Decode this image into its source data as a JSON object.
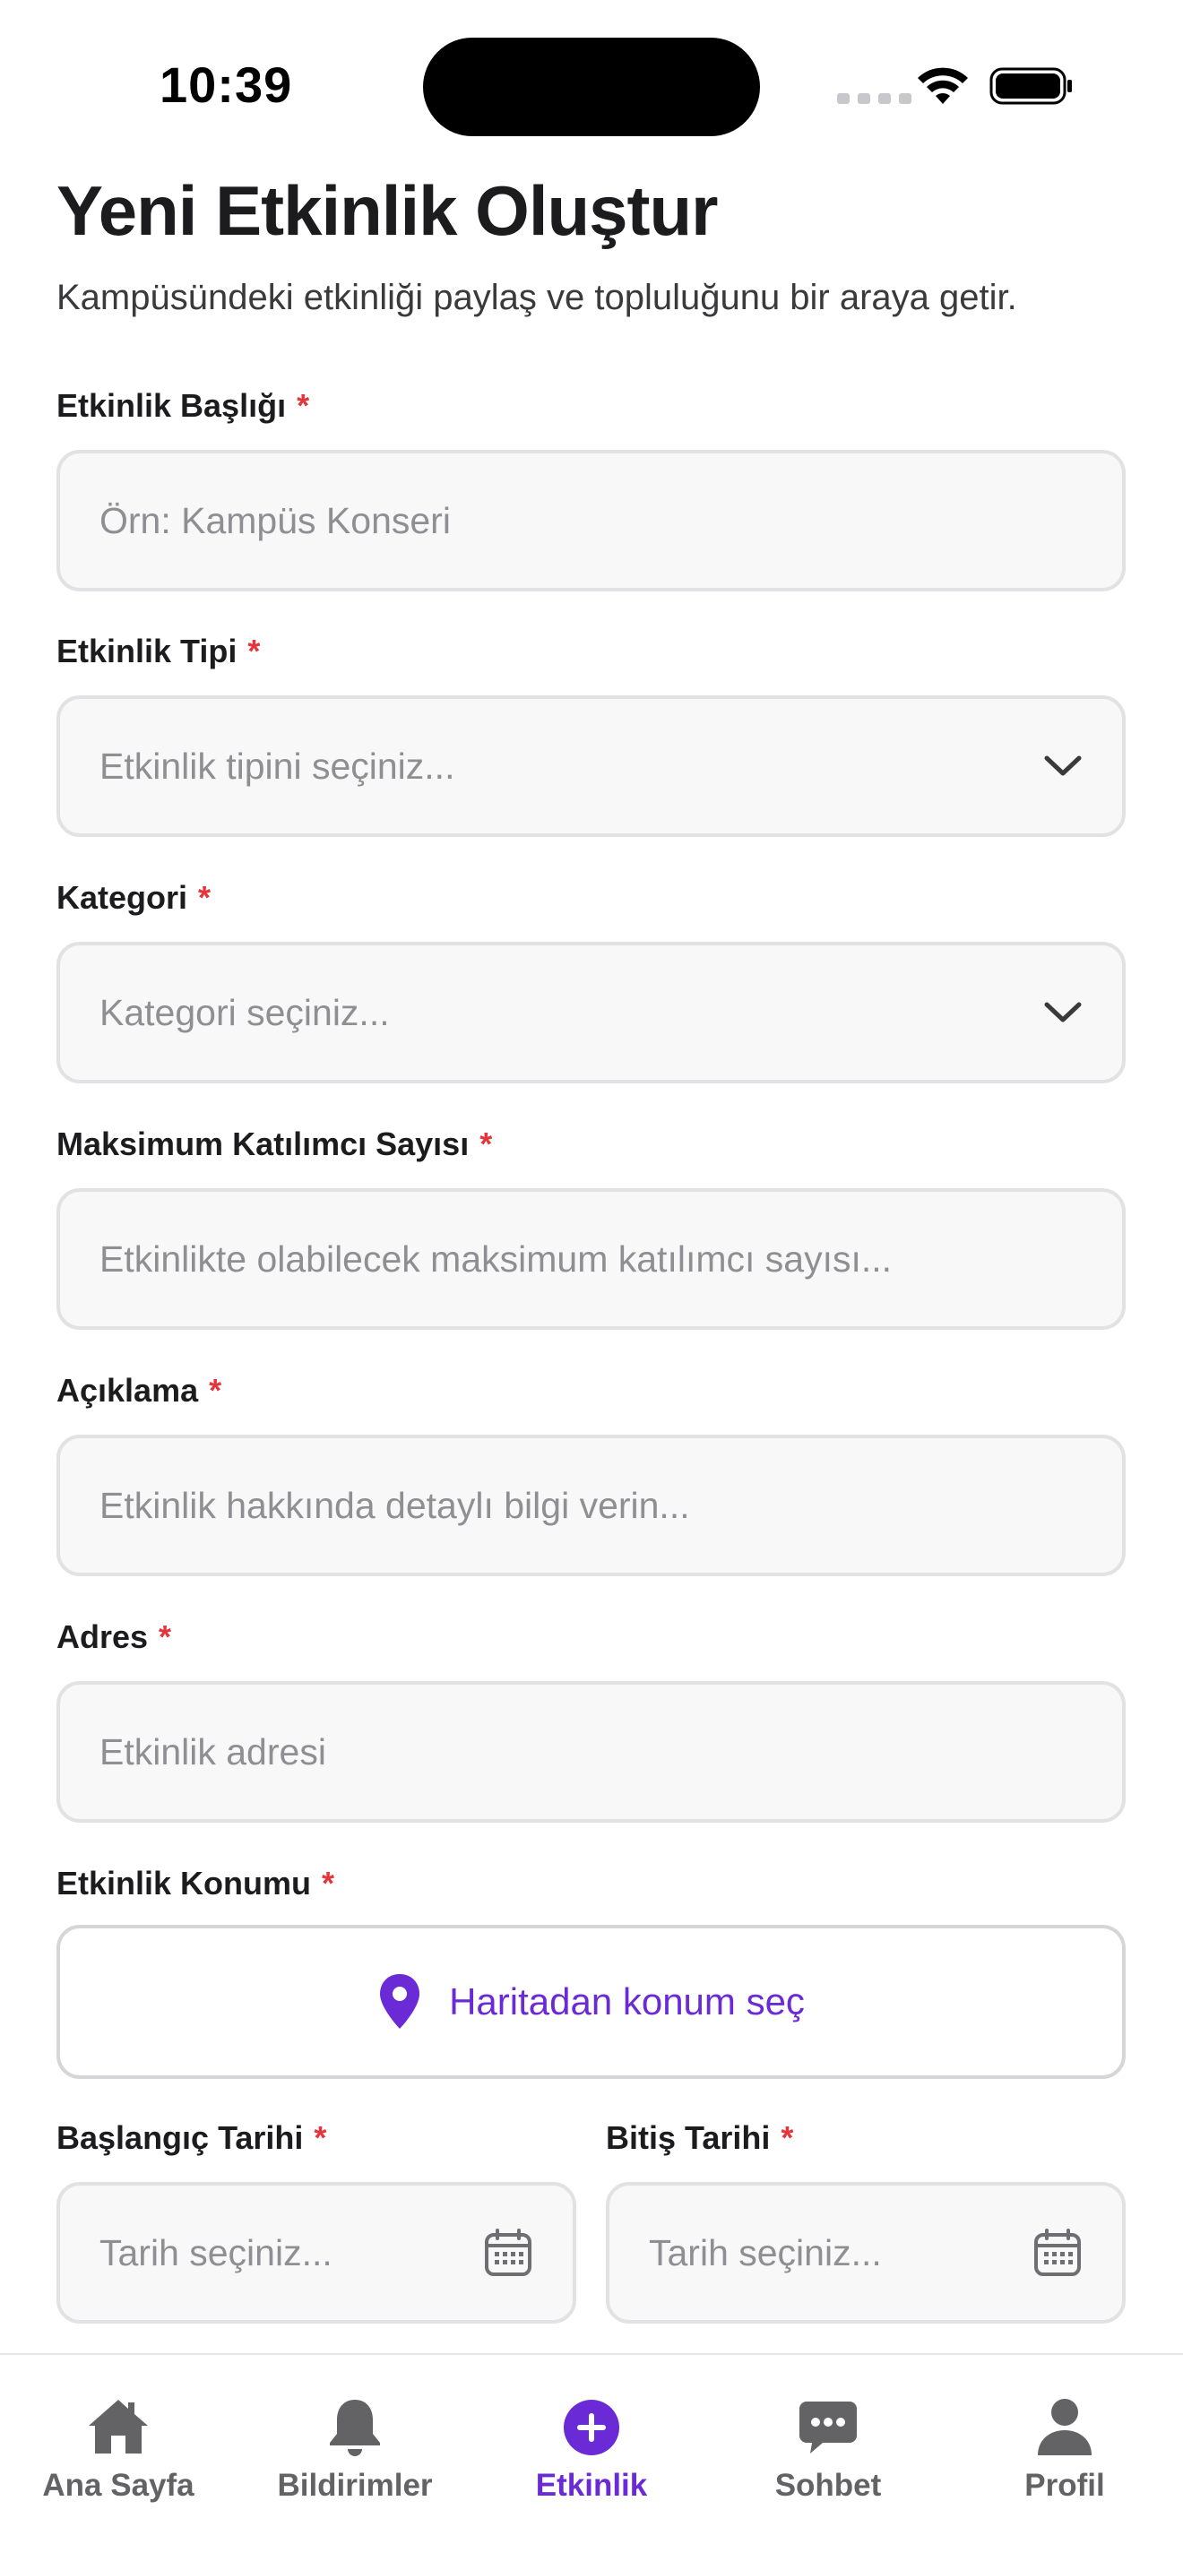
{
  "status_bar": {
    "time": "10:39"
  },
  "header": {
    "title": "Yeni Etkinlik Oluştur",
    "subtitle": "Kampüsündeki etkinliği paylaş ve topluluğunu bir araya getir."
  },
  "required_marker": "*",
  "form": {
    "title": {
      "label": "Etkinlik Başlığı",
      "placeholder": "Örn: Kampüs Konseri",
      "value": ""
    },
    "type": {
      "label": "Etkinlik Tipi",
      "placeholder": "Etkinlik tipini seçiniz..."
    },
    "category": {
      "label": "Kategori",
      "placeholder": "Kategori seçiniz..."
    },
    "max_participants": {
      "label": "Maksimum Katılımcı Sayısı",
      "placeholder": "Etkinlikte olabilecek maksimum katılımcı sayısı...",
      "value": ""
    },
    "description": {
      "label": "Açıklama",
      "placeholder": "Etkinlik hakkında detaylı bilgi verin...",
      "value": ""
    },
    "address": {
      "label": "Adres",
      "placeholder": "Etkinlik adresi",
      "value": ""
    },
    "location": {
      "label": "Etkinlik Konumu",
      "button_label": "Haritadan konum seç"
    },
    "start_date": {
      "label": "Başlangıç Tarihi",
      "placeholder": "Tarih seçiniz..."
    },
    "end_date": {
      "label": "Bitiş Tarihi",
      "placeholder": "Tarih seçiniz..."
    }
  },
  "tab_bar": {
    "active": "Etkinlik",
    "items": [
      {
        "label": "Ana Sayfa",
        "icon": "home-icon"
      },
      {
        "label": "Bildirimler",
        "icon": "bell-icon"
      },
      {
        "label": "Etkinlik",
        "icon": "plus-circle-icon"
      },
      {
        "label": "Sohbet",
        "icon": "chat-bubble-icon"
      },
      {
        "label": "Profil",
        "icon": "person-icon"
      }
    ]
  },
  "colors": {
    "accent": "#6a2bd6",
    "required": "#e5343a",
    "field_bg": "#f8f8f8",
    "field_border": "#e2e2e5",
    "tab_inactive": "#636366"
  }
}
